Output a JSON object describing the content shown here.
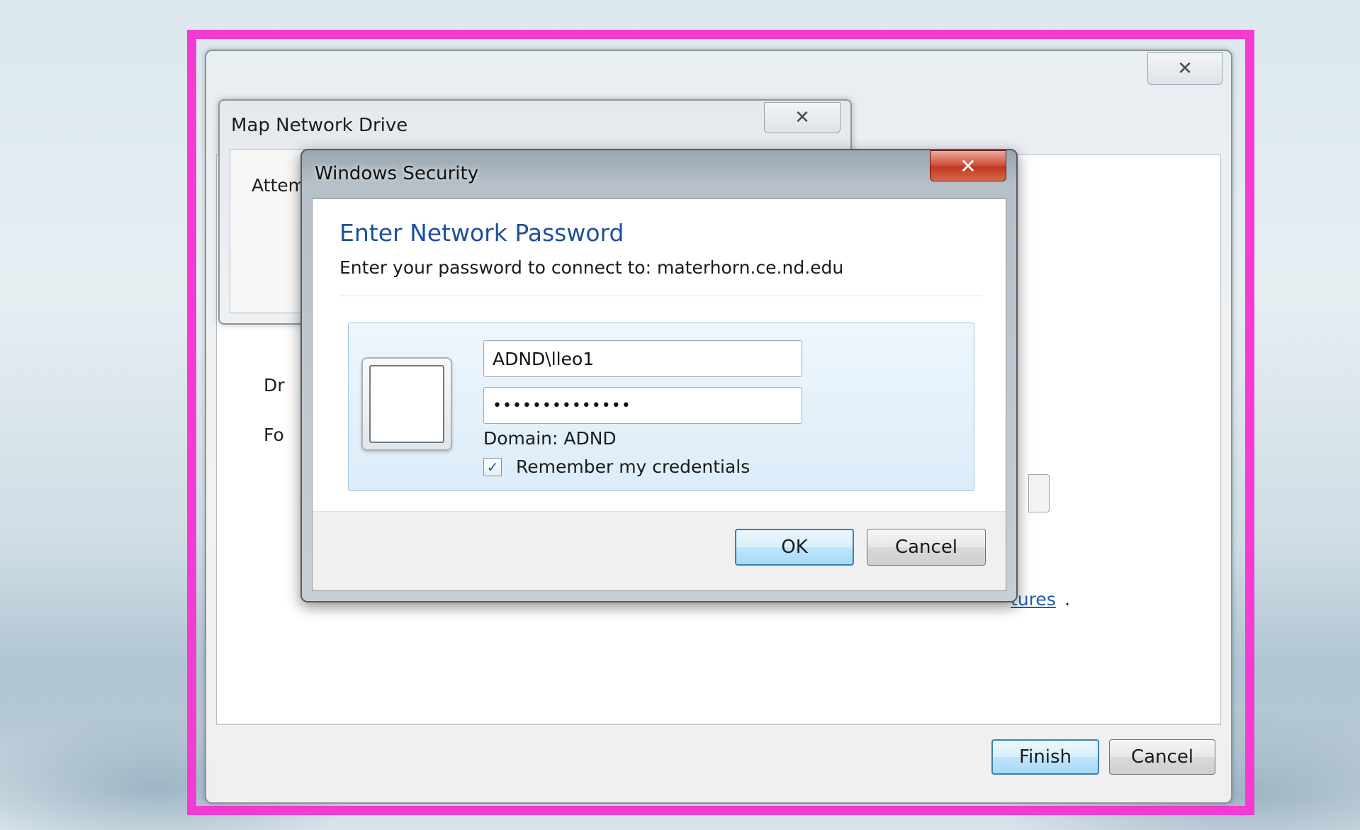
{
  "wizard": {
    "close_glyph": "✕",
    "labels": {
      "dr_fragment": "Dr",
      "fo_fragment": "Fo",
      "link_fragment": "tures",
      "link_period": "."
    },
    "finish_label": "Finish",
    "cancel_label": "Cancel"
  },
  "map_network_drive": {
    "title": "Map Network Drive",
    "close_glyph": "✕",
    "body_text": "Attem"
  },
  "windows_security": {
    "title": "Windows Security",
    "close_glyph": "✕",
    "heading": "Enter Network Password",
    "subtitle": "Enter your password to connect to: materhorn.ce.nd.edu",
    "username_value": "ADND\\lleo1",
    "password_value": "••••••••••••••",
    "domain_text": "Domain: ADND",
    "remember_checked": true,
    "remember_label": "Remember my credentials",
    "check_glyph": "✓",
    "ok_label": "OK",
    "cancel_label": "Cancel"
  },
  "colors": {
    "highlight": "#f43bd2",
    "heading": "#1e4f9c",
    "close_red": "#c0381f"
  }
}
